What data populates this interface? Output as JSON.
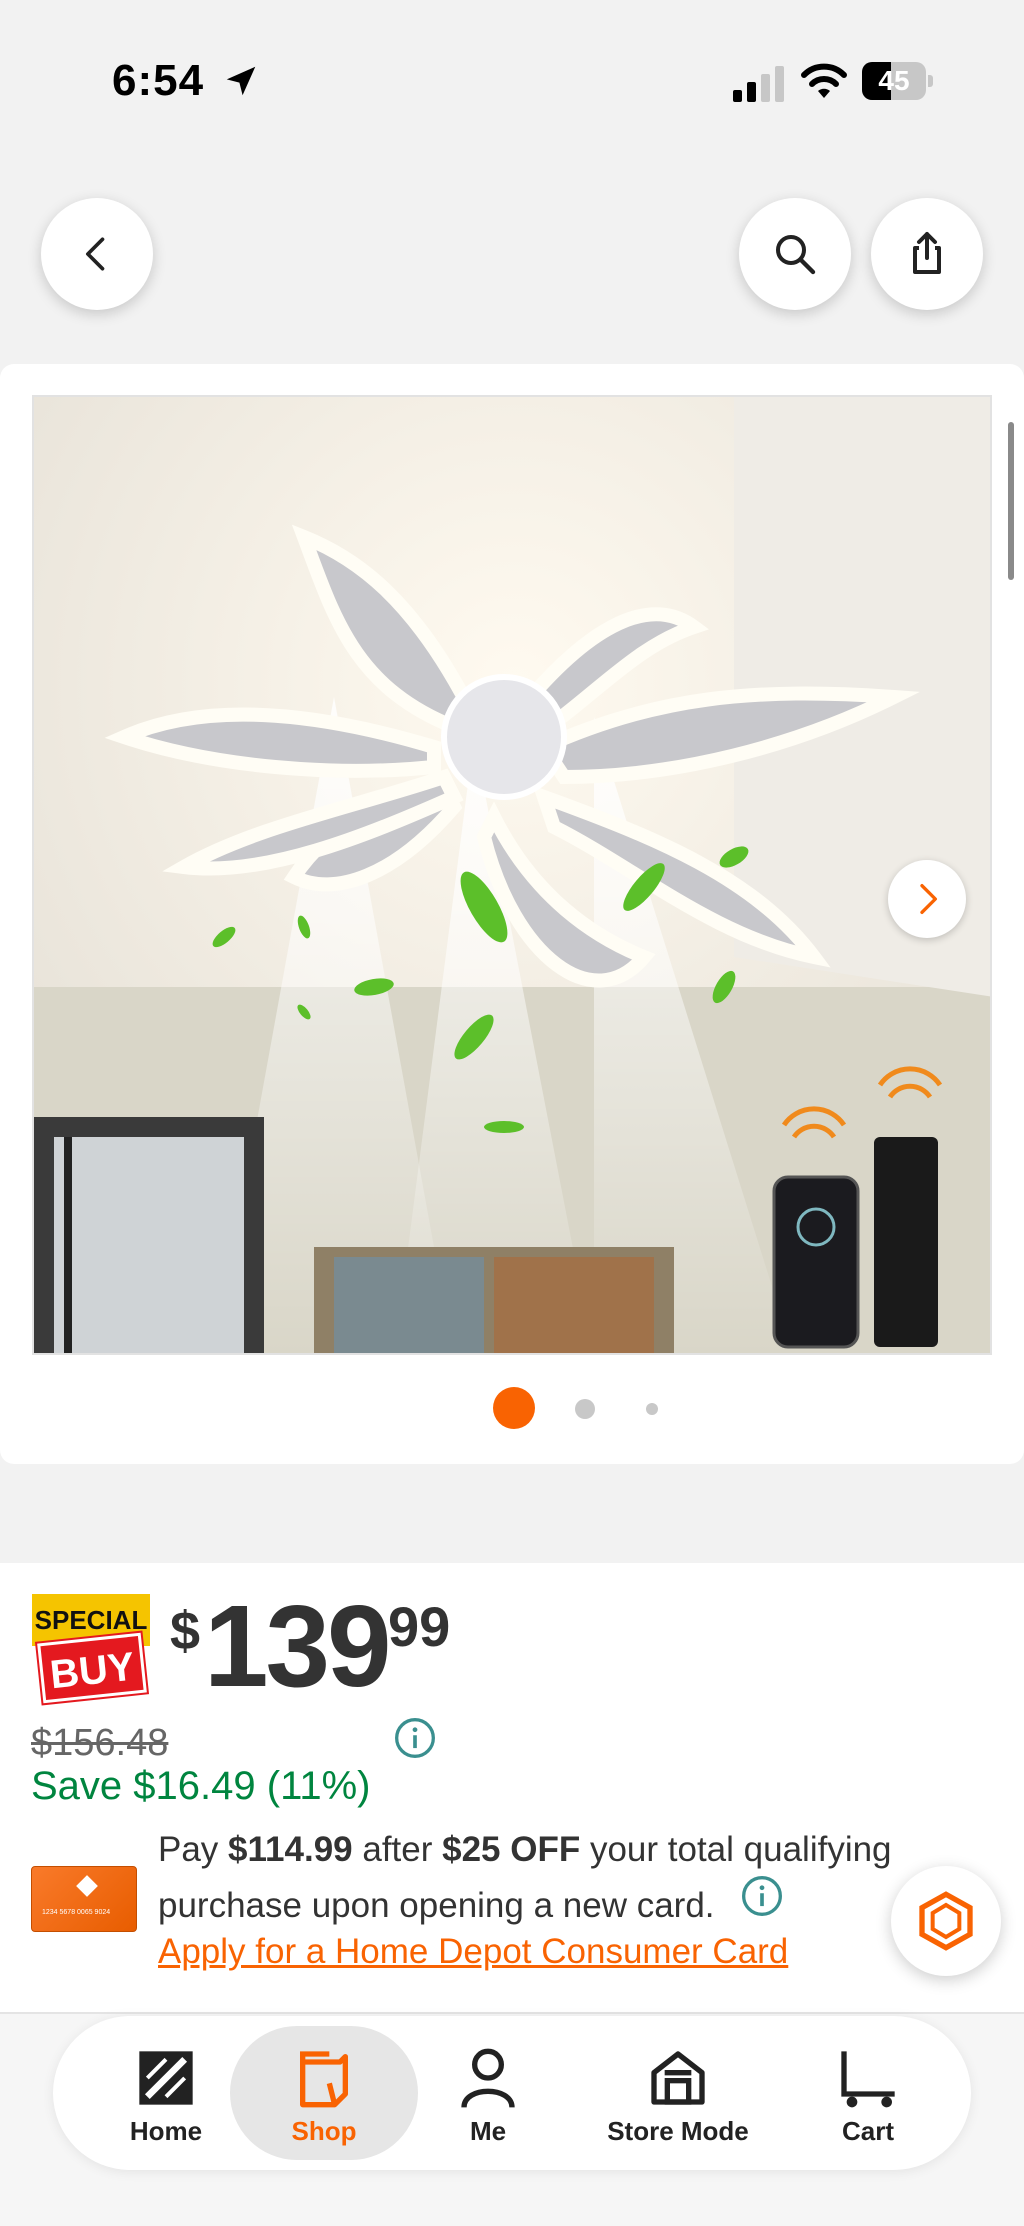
{
  "status_bar": {
    "time": "6:54",
    "battery_percent": "45",
    "battery_level": 0.45
  },
  "header": {
    "back_icon": "chevron-left-icon",
    "search_icon": "search-icon",
    "share_icon": "share-icon"
  },
  "gallery": {
    "image_alt": "Flower-shaped LED ceiling fan light with remote and app control",
    "active_index": 0,
    "total_dots": 3
  },
  "price": {
    "badge_top": "SPECIAL",
    "badge_bottom": "BUY",
    "dollar_sign": "$",
    "dollars": "139",
    "cents": "99",
    "was_price": "$156.48",
    "savings": "Save $16.49 (11%)"
  },
  "financing": {
    "pay_prefix": "Pay ",
    "pay_amount": "$114.99",
    "pay_middle": " after ",
    "discount": "$25 OFF",
    "pay_suffix": " your total qualifying purchase upon opening a new card.",
    "apply_link": "Apply for a Home Depot Consumer Card",
    "card_number": "1234 5678 0065 9024"
  },
  "nav": {
    "home": "Home",
    "shop": "Shop",
    "me": "Me",
    "store_mode": "Store Mode",
    "cart": "Cart"
  },
  "colors": {
    "brand_orange": "#f96302",
    "savings_green": "#00853f",
    "info_teal": "#3a8f8f"
  }
}
